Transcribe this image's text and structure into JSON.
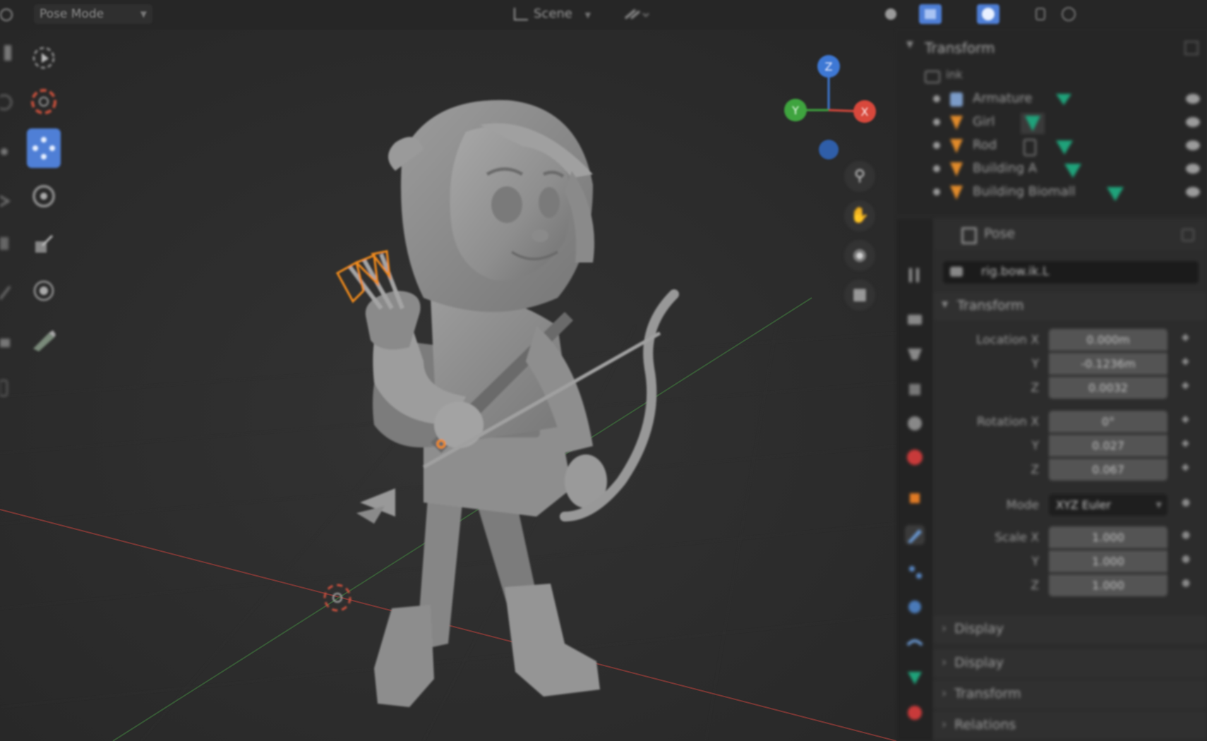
{
  "header": {
    "mode": "Pose Mode",
    "scene": "Scene"
  },
  "outliner": {
    "panel_title": "Transform",
    "root_label": "ink",
    "rows": [
      {
        "label": "Armature",
        "icon": "armature-icon"
      },
      {
        "label": "Girl",
        "icon": "mesh-icon"
      },
      {
        "label": "Rod",
        "icon": "mesh-icon"
      },
      {
        "label": "Building A",
        "icon": "mesh-icon"
      },
      {
        "label": "Building Biomall",
        "icon": "mesh-icon"
      }
    ]
  },
  "properties": {
    "header_label": "Pose",
    "bone_name": "rig.bow.ik.L",
    "transform_title": "Transform",
    "location_label": "Location X",
    "location_x": "0.000m",
    "location_y": "-0.1236m",
    "location_z": "0.0032",
    "rotation_label": "Rotation X",
    "rotation_x": "0°",
    "rotation_y": "0.027",
    "rotation_z": "0.067",
    "mode_label": "Mode",
    "mode_value": "XYZ Euler",
    "scale_label": "Scale X",
    "scale_x": "1.000",
    "scale_y": "1.000",
    "scale_z": "1.000",
    "axis_y": "Y",
    "axis_z": "Z",
    "sections": [
      "Display",
      "Display",
      "Transform",
      "Relations"
    ]
  },
  "colors": {
    "accent_blue": "#4f7fd6",
    "axis_x": "#d8483c",
    "axis_y": "#3fa43f",
    "axis_z": "#3e78d4",
    "selection_orange": "#f08a1c",
    "vertex_group_green": "#1fa27a"
  }
}
